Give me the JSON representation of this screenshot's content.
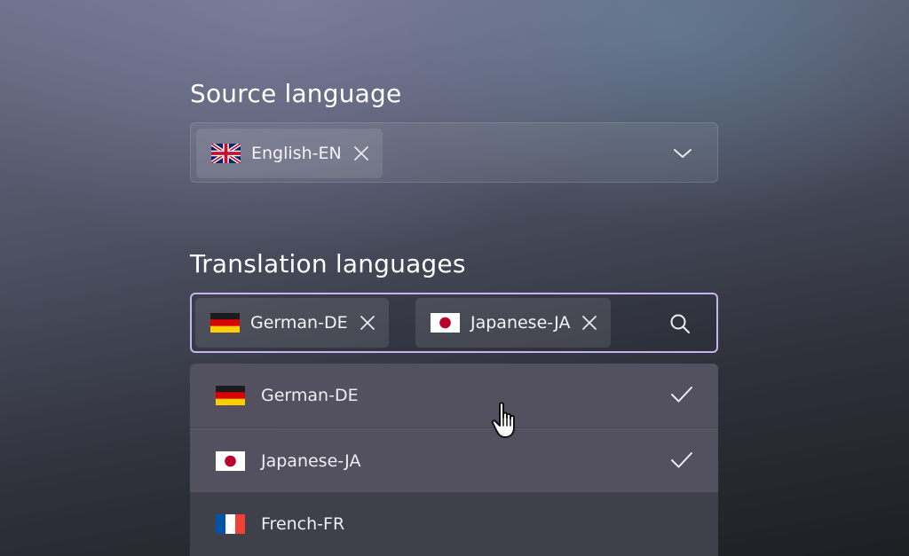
{
  "source": {
    "title": "Source language",
    "selected": [
      {
        "label": "English-EN",
        "flag": "uk-flag-icon"
      }
    ],
    "toggle_icon": "chevron-down-icon"
  },
  "translation": {
    "title": "Translation languages",
    "selected": [
      {
        "label": "German-DE",
        "flag": "germany-flag-icon"
      },
      {
        "label": "Japanese-JA",
        "flag": "japan-flag-icon"
      }
    ],
    "search_icon": "search-icon"
  },
  "dropdown": {
    "options": [
      {
        "label": "German-DE",
        "flag": "germany-flag-icon",
        "checked": true
      },
      {
        "label": "Japanese-JA",
        "flag": "japan-flag-icon",
        "checked": true
      },
      {
        "label": "French-FR",
        "flag": "france-flag-icon",
        "checked": false
      }
    ]
  },
  "colors": {
    "focus_border": "#c8b3ee",
    "text": "#ffffff"
  }
}
